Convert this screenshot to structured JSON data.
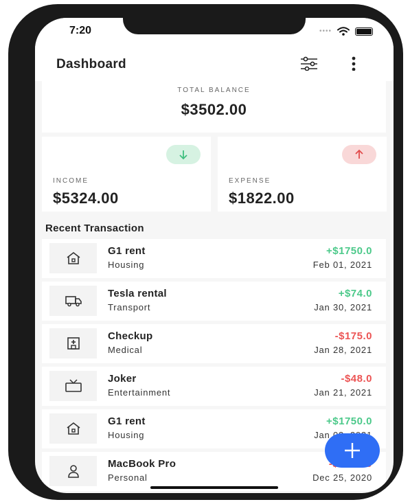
{
  "status_bar": {
    "time": "7:20"
  },
  "header": {
    "title": "Dashboard"
  },
  "balance": {
    "label": "TOTAL BALANCE",
    "amount": "$3502.00"
  },
  "income": {
    "label": "INCOME",
    "amount": "$5324.00"
  },
  "expense": {
    "label": "EXPENSE",
    "amount": "$1822.00"
  },
  "section_title": "Recent Transaction",
  "colors": {
    "positive": "#4cc98a",
    "negative": "#ec5454",
    "accent": "#2f6ef5"
  },
  "transactions": [
    {
      "name": "G1 rent",
      "category": "Housing",
      "amount": "+$1750.0",
      "date": "Feb 01, 2021",
      "icon": "house-icon"
    },
    {
      "name": "Tesla rental",
      "category": "Transport",
      "amount": "+$74.0",
      "date": "Jan 30, 2021",
      "icon": "truck-icon"
    },
    {
      "name": "Checkup",
      "category": "Medical",
      "amount": "-$175.0",
      "date": "Jan 28, 2021",
      "icon": "medical-icon"
    },
    {
      "name": "Joker",
      "category": "Entertainment",
      "amount": "-$48.0",
      "date": "Jan 21, 2021",
      "icon": "tv-icon"
    },
    {
      "name": "G1 rent",
      "category": "Housing",
      "amount": "+$1750.0",
      "date": "Jan 03, 2021",
      "icon": "house-icon"
    },
    {
      "name": "MacBook Pro",
      "category": "Personal",
      "amount": "-$1500.0",
      "date": "Dec 25, 2020",
      "icon": "person-icon"
    }
  ]
}
